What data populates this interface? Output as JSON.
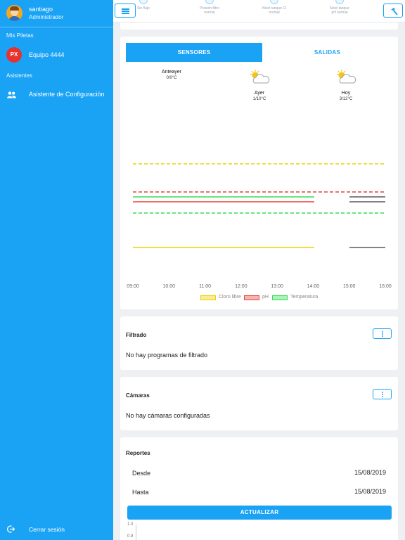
{
  "sidebar": {
    "user": {
      "name": "santiago",
      "role": "Administrador"
    },
    "section_pools": "Mis Piletas",
    "pool": {
      "badge": "PX",
      "name": "Equipo 4444"
    },
    "section_assistants": "Asistentes",
    "assistant": {
      "label": "Asistente de Configuración",
      "icon": "people-icon"
    },
    "logout": {
      "label": "Cerrar sesión",
      "icon": "logout-icon"
    }
  },
  "topbar": {
    "menu_icon": "hamburger-icon",
    "tool_icon": "hammer-icon",
    "status_items": [
      {
        "line1": "Sin flujo",
        "line2": ""
      },
      {
        "line1": "Presión filtro",
        "line2": "normal"
      },
      {
        "line1": "Nivel tanque Cl",
        "line2": "normal"
      },
      {
        "line1": "Nivel tanque",
        "line2": "pH normal"
      }
    ]
  },
  "sensors": {
    "tabs": {
      "active": "SENSORES",
      "inactive": "SALIDAS"
    },
    "weather": [
      {
        "day": "Anteayer",
        "temp": "0/0°C",
        "icon": ""
      },
      {
        "day": "Ayer",
        "temp": "1/10°C",
        "icon": "partly-cloudy-icon"
      },
      {
        "day": "Hoy",
        "temp": "3/12°C",
        "icon": "partly-cloudy-icon"
      }
    ]
  },
  "chart_data": {
    "type": "line",
    "x": [
      "09:00",
      "10:00",
      "11:00",
      "12:00",
      "13:00",
      "14:00",
      "15:00",
      "16:00"
    ],
    "series": [
      {
        "name": "Cloro libre",
        "color": "#f0d000"
      },
      {
        "name": "pH",
        "color": "#e8443a"
      },
      {
        "name": "Temperatura",
        "color": "#33dd55"
      }
    ],
    "grid": false,
    "legend": "bottom-center",
    "colors": {
      "gap": "#5a5a5a"
    }
  },
  "filtrado": {
    "title": "Filtrado",
    "text": "No hay programas de filtrado"
  },
  "camaras": {
    "title": "Cámaras",
    "text": "No hay cámaras configuradas"
  },
  "reportes": {
    "title": "Reportes",
    "desde_label": "Desde",
    "desde_value": "15/08/2019",
    "hasta_label": "Hasta",
    "hasta_value": "15/08/2019",
    "button": "ACTUALIZAR",
    "y_ticks": [
      "1.0",
      "0.9"
    ]
  },
  "colors": {
    "accent": "#1aa3f5",
    "danger": "#e8322d"
  }
}
